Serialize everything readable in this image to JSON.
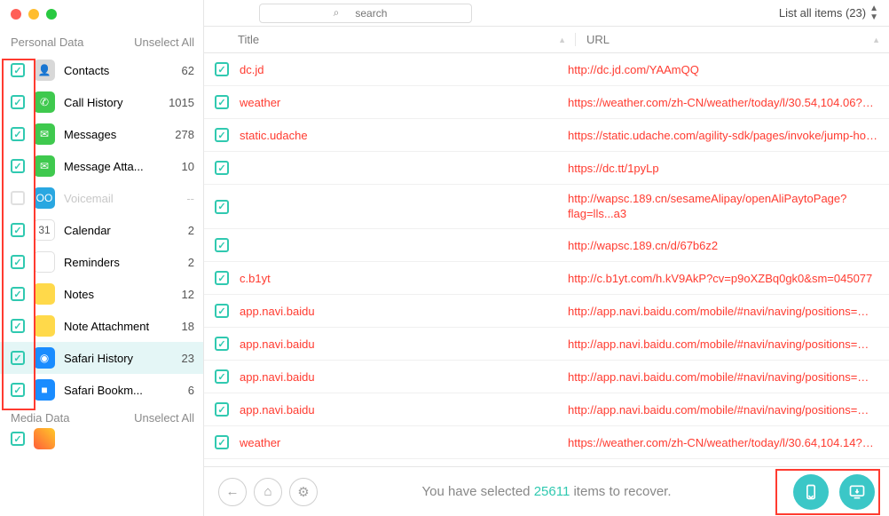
{
  "search": {
    "placeholder": "search"
  },
  "filter": {
    "label": "List all items (23)"
  },
  "sidebar": {
    "sections": {
      "personal": {
        "title": "Personal Data",
        "action": "Unselect All"
      },
      "media": {
        "title": "Media Data",
        "action": "Unselect All"
      }
    },
    "items": [
      {
        "label": "Contacts",
        "count": "62",
        "iconClass": "ic-contacts",
        "glyph": "👤",
        "checked": true
      },
      {
        "label": "Call History",
        "count": "1015",
        "iconClass": "ic-call",
        "glyph": "✆",
        "checked": true
      },
      {
        "label": "Messages",
        "count": "278",
        "iconClass": "ic-msg",
        "glyph": "✉",
        "checked": true
      },
      {
        "label": "Message Atta...",
        "count": "10",
        "iconClass": "ic-msga",
        "glyph": "✉",
        "checked": true
      },
      {
        "label": "Voicemail",
        "count": "--",
        "iconClass": "ic-vm",
        "glyph": "OO",
        "checked": false,
        "disabled": true
      },
      {
        "label": "Calendar",
        "count": "2",
        "iconClass": "ic-cal",
        "glyph": "31",
        "checked": true
      },
      {
        "label": "Reminders",
        "count": "2",
        "iconClass": "ic-rem",
        "glyph": "",
        "checked": true
      },
      {
        "label": "Notes",
        "count": "12",
        "iconClass": "ic-notes",
        "glyph": "",
        "checked": true
      },
      {
        "label": "Note Attachment",
        "count": "18",
        "iconClass": "ic-notea",
        "glyph": "",
        "checked": true
      },
      {
        "label": "Safari History",
        "count": "23",
        "iconClass": "ic-safari",
        "glyph": "◉",
        "checked": true,
        "active": true
      },
      {
        "label": "Safari Bookm...",
        "count": "6",
        "iconClass": "ic-bookmark",
        "glyph": "■",
        "checked": true
      }
    ]
  },
  "theaders": {
    "title": "Title",
    "url": "URL"
  },
  "rows": [
    {
      "title": "dc.jd",
      "url": "http://dc.jd.com/YAAmQQ"
    },
    {
      "title": "weather",
      "url": "https://weather.com/zh-CN/weather/today/l/30.54,104.06?par..."
    },
    {
      "title": "static.udache",
      "url": "https://static.udache.com/agility-sdk/pages/invoke/jump-hom..."
    },
    {
      "title": "",
      "url": "https://dc.tt/1pyLp"
    },
    {
      "title": "",
      "url": "http://wapsc.189.cn/sesameAlipay/openAliPaytoPage?flag=lls...a3",
      "tall": true
    },
    {
      "title": "",
      "url": "http://wapsc.189.cn/d/67b6z2"
    },
    {
      "title": "c.b1yt",
      "url": "http://c.b1yt.com/h.kV9AkP?cv=p9oXZBq0gk0&sm=045077"
    },
    {
      "title": "app.navi.baidu",
      "url": "http://app.navi.baidu.com/mobile/#navi/naving/positions=%5..."
    },
    {
      "title": "app.navi.baidu",
      "url": "http://app.navi.baidu.com/mobile/#navi/naving/positions=%5..."
    },
    {
      "title": "app.navi.baidu",
      "url": "http://app.navi.baidu.com/mobile/#navi/naving/positions=%5..."
    },
    {
      "title": "app.navi.baidu",
      "url": "http://app.navi.baidu.com/mobile/#navi/naving/positions=%5..."
    },
    {
      "title": "weather",
      "url": "https://weather.com/zh-CN/weather/today/l/30.64,104.14?par..."
    }
  ],
  "footer": {
    "pre": "You have selected ",
    "count": "25611",
    "post": " items to recover."
  }
}
